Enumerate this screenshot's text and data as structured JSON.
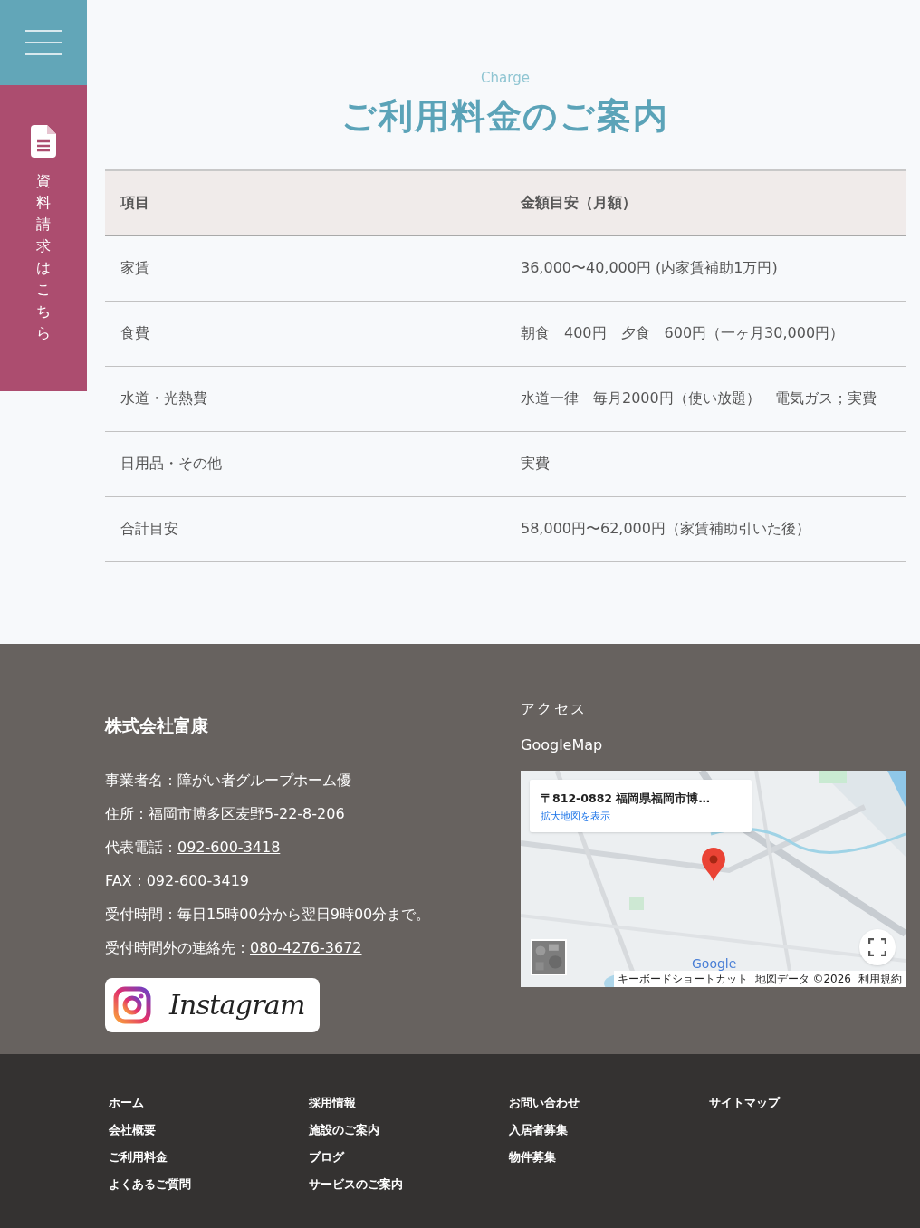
{
  "side_rail": {
    "request_label": "資料請求はこちら"
  },
  "section": {
    "eyebrow": "Charge",
    "title": "ご利用料金のご案内"
  },
  "table": {
    "columns": [
      "項目",
      "金額目安（月額）"
    ],
    "rows": [
      [
        "家賃",
        "36,000〜40,000円 (内家賃補助1万円)"
      ],
      [
        "食費",
        "朝食　400円　夕食　600円（一ヶ月30,000円）"
      ],
      [
        "水道・光熱費",
        "水道一律　毎月2000円（使い放題）　電気ガス；実費"
      ],
      [
        "日用品・その他",
        "実費"
      ],
      [
        "合計目安",
        "58,000円〜62,000円（家賃補助引いた後）"
      ]
    ]
  },
  "footer": {
    "company": "株式会社富康",
    "info": [
      {
        "label": "事業者名：",
        "value": "障がい者グループホーム優",
        "link": false
      },
      {
        "label": "住所：",
        "value": "福岡市博多区麦野5-22-8-206",
        "link": false
      },
      {
        "label": "代表電話：",
        "value": "092-600-3418",
        "link": true
      },
      {
        "label": "FAX：",
        "value": "092-600-3419",
        "link": false
      },
      {
        "label": "受付時間：",
        "value": "毎日15時00分から翌日9時00分まで。",
        "link": false
      },
      {
        "label": "受付時間外の連絡先：",
        "value": "080-4276-3672",
        "link": true
      }
    ],
    "instagram": "Instagram",
    "access_heading": "アクセス",
    "map_label": "GoogleMap",
    "map": {
      "address": "〒812-0882 福岡県福岡市博…",
      "larger_map_link": "拡大地図を表示",
      "logo": "Google",
      "attribution": [
        "キーボードショートカット",
        "地図データ ©2026",
        "利用規約"
      ]
    }
  },
  "site_links": [
    [
      "ホーム",
      "会社概要",
      "ご利用料金",
      "よくあるご質問"
    ],
    [
      "採用情報",
      "施設のご案内",
      "ブログ",
      "サービスのご案内"
    ],
    [
      "お問い合わせ",
      "入居者募集",
      "物件募集"
    ],
    [
      "サイトマップ"
    ]
  ]
}
